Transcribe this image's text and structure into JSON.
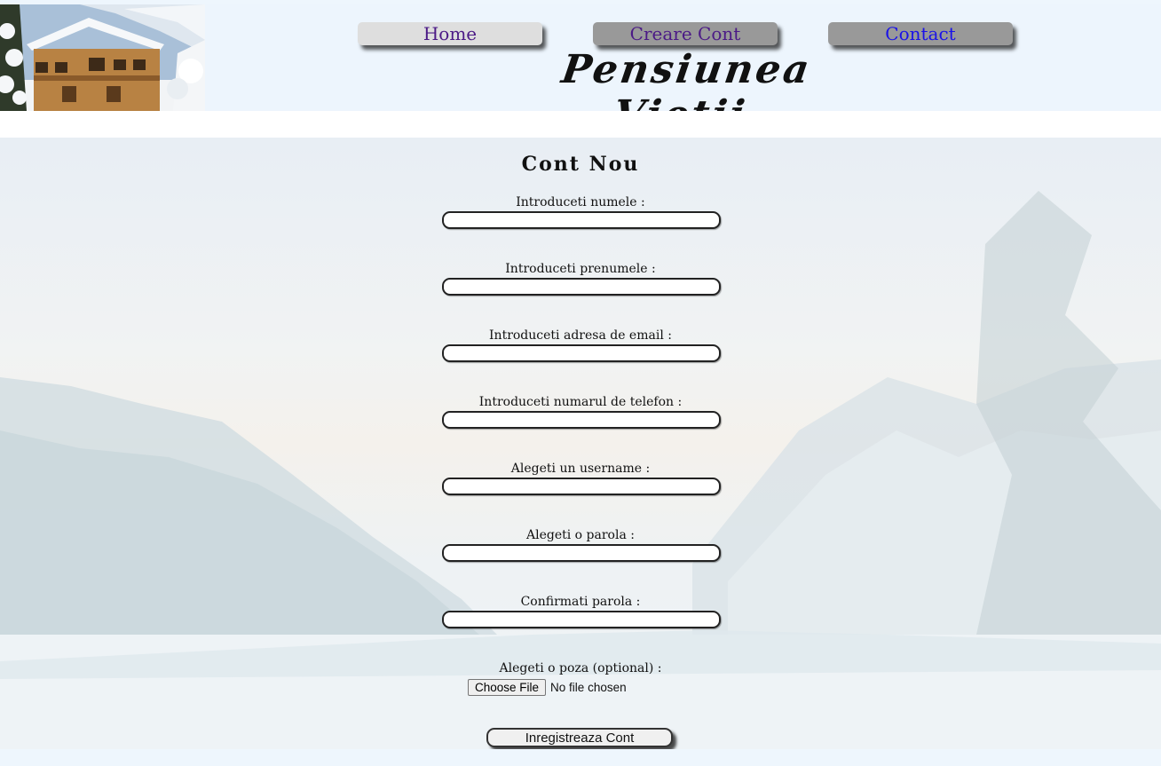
{
  "header": {
    "logo_alt": "chalet in snow",
    "nav": [
      {
        "label": "Home",
        "color": "#4b1a86"
      },
      {
        "label": "Creare Cont",
        "color": "#4b1a86"
      },
      {
        "label": "Contact",
        "color": "#1a12e8"
      }
    ],
    "site_title": "Pensiunea  Vietii"
  },
  "form": {
    "title": "Cont  Nou",
    "fields": [
      {
        "label": "Introduceti numele :",
        "value": ""
      },
      {
        "label": "Introduceti prenumele :",
        "value": ""
      },
      {
        "label": "Introduceti adresa de email :",
        "value": ""
      },
      {
        "label": "Introduceti numarul de telefon :",
        "value": ""
      },
      {
        "label": "Alegeti un username :",
        "value": ""
      },
      {
        "label": "Alegeti o parola :",
        "value": ""
      },
      {
        "label": "Confirmati parola :",
        "value": ""
      }
    ],
    "photo_label": "Alegeti o poza (optional) :",
    "file_button": "Choose File",
    "file_status": "No file chosen",
    "submit_label": "Inregistreaza Cont"
  }
}
